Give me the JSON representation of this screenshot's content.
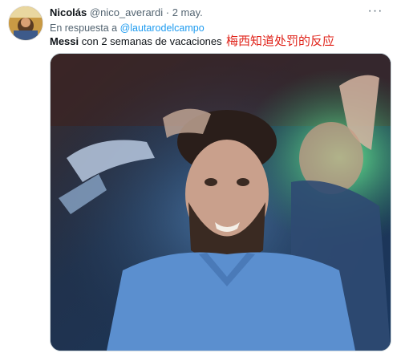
{
  "tweet": {
    "author_name": "Nicolás",
    "author_handle": "@nico_averardi",
    "separator": "·",
    "date": "2 may.",
    "more_label": "···",
    "reply_prefix": "En respuesta a",
    "reply_to": "@lautarodelcampo",
    "text_bold": "Messi",
    "text_rest": " con 2 semanas de vacaciones",
    "overlay_caption": "梅西知道处罚的反应"
  },
  "icons": {
    "more": "more-horizontal-icon"
  },
  "colors": {
    "name": "#0f1419",
    "secondary": "#536471",
    "link": "#1d9bf0",
    "caption_red": "#e0241b",
    "media_border": "#cfd9de"
  }
}
